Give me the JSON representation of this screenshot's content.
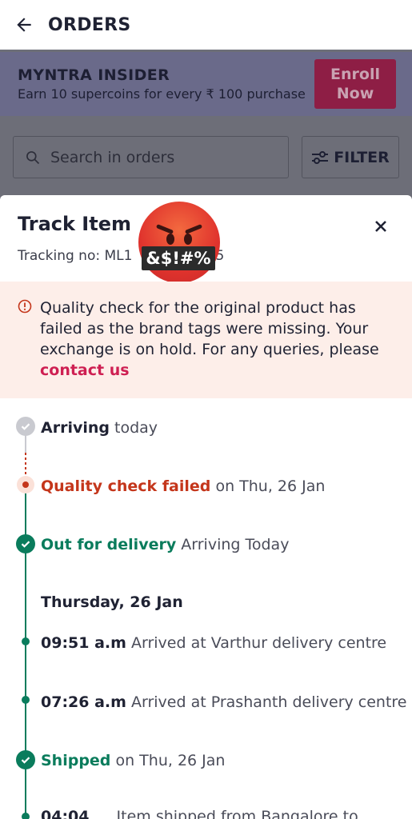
{
  "header": {
    "title": "ORDERS"
  },
  "insider": {
    "title": "MYNTRA INSIDER",
    "subtitle": "Earn 10 supercoins for every ₹ 100 purchase",
    "enroll_line1": "Enroll",
    "enroll_line2": "Now"
  },
  "search": {
    "placeholder": "Search in orders"
  },
  "filter": {
    "label": "FILTER"
  },
  "sheet": {
    "title": "Track Item",
    "tracking_prefix": "Tracking no: ML1",
    "tracking_suffix": "5",
    "censor_text": "&$!#%",
    "alert": {
      "text": "Quality check for the original product has failed as the brand tags were missing. Your exchange is on hold. For any queries, please",
      "link": "contact us"
    },
    "timeline": [
      {
        "status": "Arriving",
        "detail": "today"
      },
      {
        "status": "Quality check failed",
        "detail": "on Thu, 26 Jan"
      },
      {
        "status": "Out for delivery",
        "detail": "Arriving Today"
      },
      {
        "heading": "Thursday, 26 Jan"
      },
      {
        "time": "09:51 a.m",
        "detail": "Arrived at Varthur delivery centre"
      },
      {
        "time": "07:26 a.m",
        "detail": "Arrived at Prashanth delivery centre"
      },
      {
        "status": "Shipped",
        "detail": "on Thu, 26 Jan"
      },
      {
        "time": "04:04",
        "detail": "Item shipped from Bangalore to"
      }
    ]
  },
  "colors": {
    "accent_pink": "#ce1f52",
    "success_green": "#0a7c5c",
    "error_red": "#c4361b",
    "alert_bg": "#fdeee9"
  }
}
